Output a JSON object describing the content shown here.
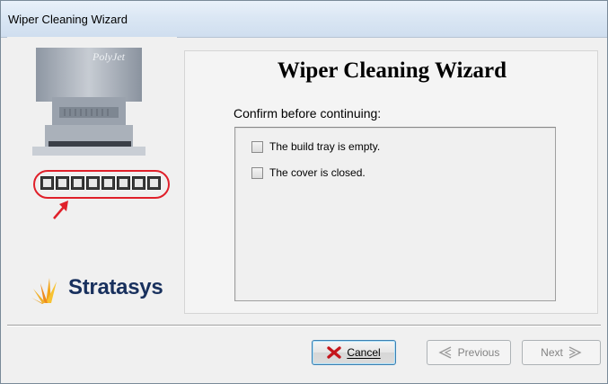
{
  "window": {
    "title": "Wiper Cleaning Wizard"
  },
  "left_panel": {
    "printer_badge": "PolyJet",
    "logo_text": "Stratasys",
    "slot_count": 8,
    "highlight_color": "#e0202a"
  },
  "main": {
    "heading": "Wiper Cleaning Wizard",
    "confirm_label": "Confirm before continuing:",
    "checklist": [
      {
        "label": "The build tray is empty.",
        "checked": false
      },
      {
        "label": "The cover is closed.",
        "checked": false
      }
    ]
  },
  "buttons": {
    "cancel": {
      "label": "Cancel",
      "icon": "red-x-icon"
    },
    "previous": {
      "label": "Previous",
      "icon": "chevron-left-icon",
      "enabled": false
    },
    "next": {
      "label": "Next",
      "icon": "chevron-right-icon",
      "enabled": false
    }
  }
}
